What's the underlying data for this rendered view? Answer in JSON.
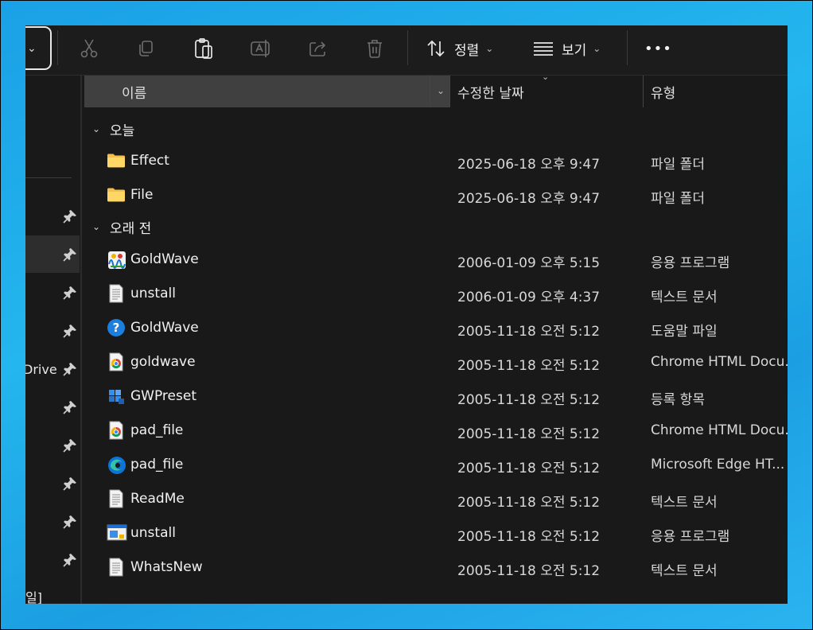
{
  "toolbar": {
    "sort_label": "정렬",
    "view_label": "보기",
    "more_label": "•••"
  },
  "nav": {
    "drive_label": "Drive",
    "bottom_label": "일]"
  },
  "columns": {
    "name": "이름",
    "date_modified": "수정한 날짜",
    "type": "유형"
  },
  "groups": {
    "today": "오늘",
    "long_ago": "오래 전"
  },
  "files_today": [
    {
      "name": "Effect",
      "date": "2025-06-18 오후 9:47",
      "type": "파일 폴더",
      "icon": "folder-icon"
    },
    {
      "name": "File",
      "date": "2025-06-18 오후 9:47",
      "type": "파일 폴더",
      "icon": "folder-icon"
    }
  ],
  "files_old": [
    {
      "name": "GoldWave",
      "date": "2006-01-09 오후 5:15",
      "type": "응용 프로그램",
      "icon": "goldwave-app-icon"
    },
    {
      "name": "unstall",
      "date": "2006-01-09 오후 4:37",
      "type": "텍스트 문서",
      "icon": "text-document-icon"
    },
    {
      "name": "GoldWave",
      "date": "2005-11-18 오전 5:12",
      "type": "도움말 파일",
      "icon": "help-file-icon"
    },
    {
      "name": "goldwave",
      "date": "2005-11-18 오전 5:12",
      "type": "Chrome HTML Docu...",
      "icon": "chrome-html-icon"
    },
    {
      "name": "GWPreset",
      "date": "2005-11-18 오전 5:12",
      "type": "등록 항목",
      "icon": "registry-entry-icon"
    },
    {
      "name": "pad_file",
      "date": "2005-11-18 오전 5:12",
      "type": "Chrome HTML Docu...",
      "icon": "chrome-html-icon"
    },
    {
      "name": "pad_file",
      "date": "2005-11-18 오전 5:12",
      "type": "Microsoft Edge HT...",
      "icon": "edge-html-icon"
    },
    {
      "name": "ReadMe",
      "date": "2005-11-18 오전 5:12",
      "type": "텍스트 문서",
      "icon": "text-document-icon"
    },
    {
      "name": "unstall",
      "date": "2005-11-18 오전 5:12",
      "type": "응용 프로그램",
      "icon": "app-window-icon"
    },
    {
      "name": "WhatsNew",
      "date": "2005-11-18 오전 5:12",
      "type": "텍스트 문서",
      "icon": "text-document-icon"
    }
  ],
  "colors": {
    "window_bg": "#191919",
    "header_name_bg": "#404040",
    "folder": "#f3c14b",
    "desktop": "#1fa9ea"
  }
}
